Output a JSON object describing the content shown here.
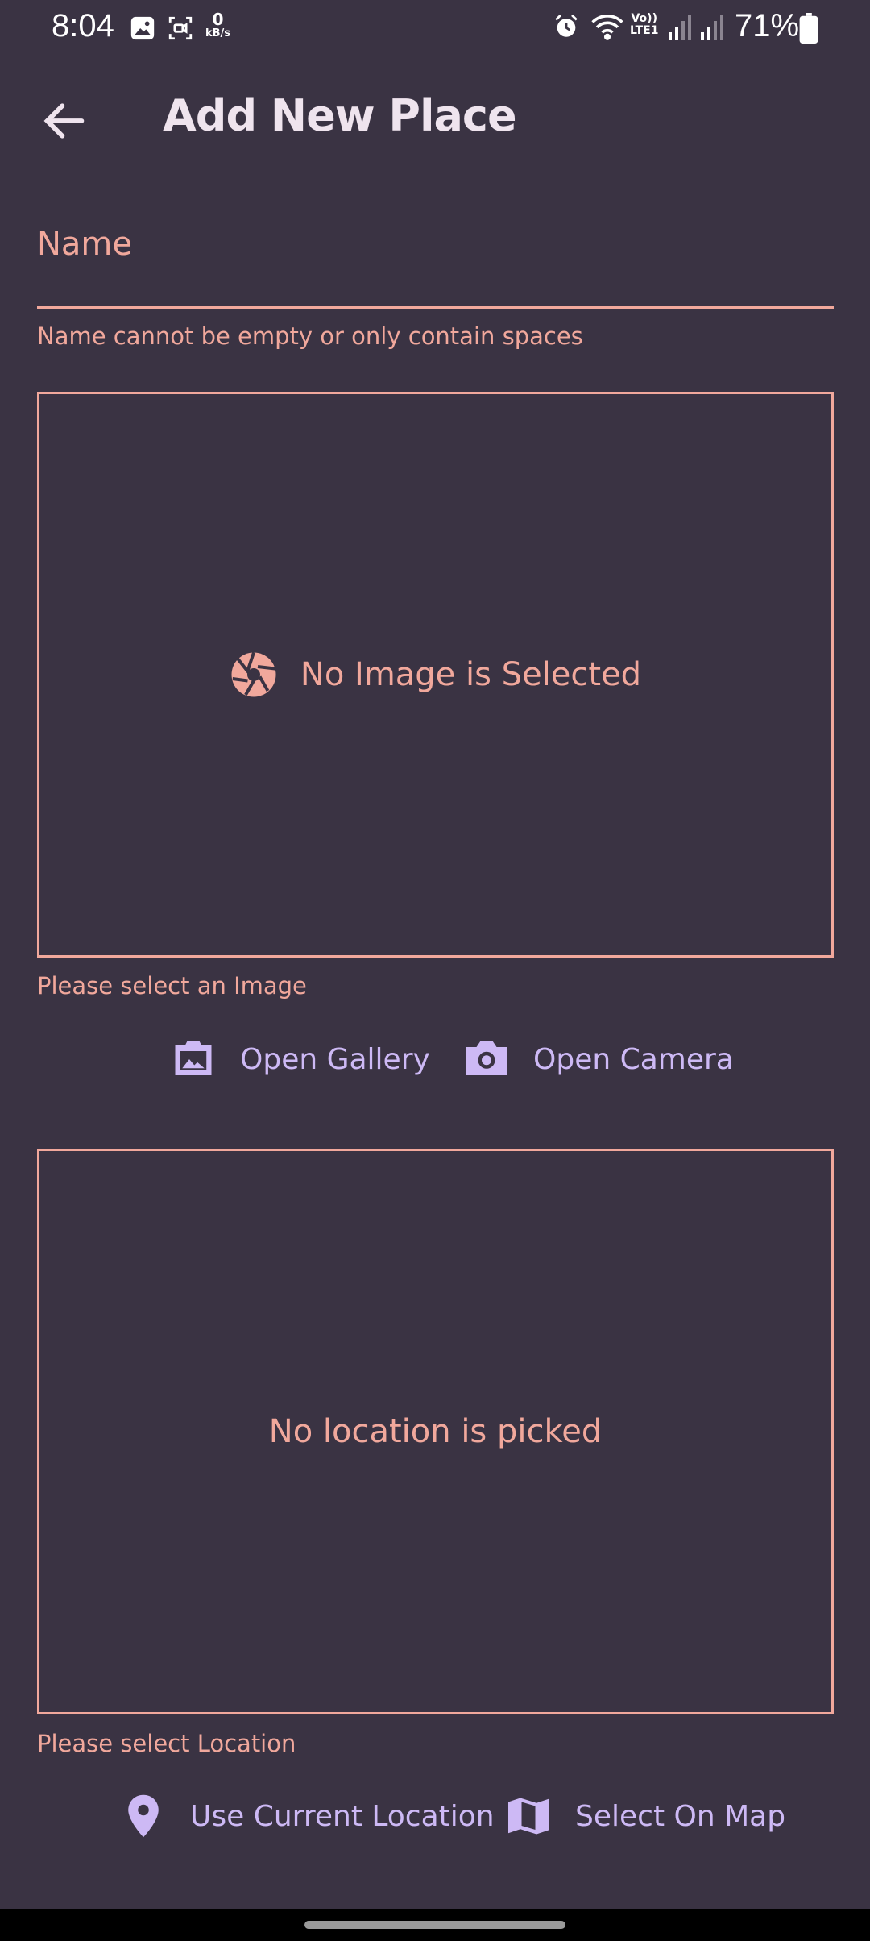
{
  "status_bar": {
    "time": "8:04",
    "speed_value": "0",
    "speed_unit": "kB/s",
    "volte_line1": "Vo))",
    "volte_line2": "LTE1",
    "battery": "71%"
  },
  "app_bar": {
    "title": "Add New Place",
    "back_icon": "arrow-left-icon"
  },
  "form": {
    "name_placeholder": "Name",
    "name_value": "",
    "name_error": "Name cannot be empty or only contain spaces"
  },
  "image_section": {
    "placeholder": "No Image is Selected",
    "placeholder_icon": "camera-shutter-icon",
    "error": "Please select an Image",
    "gallery_label": "Open Gallery",
    "gallery_icon": "gallery-icon",
    "camera_label": "Open Camera",
    "camera_icon": "camera-icon"
  },
  "location_section": {
    "placeholder": "No location is picked",
    "error": "Please select Location",
    "current_location_label": "Use Current Location",
    "current_location_icon": "location-pin-icon",
    "map_label": "Select On Map",
    "map_icon": "map-icon"
  },
  "colors": {
    "background": "#3a3343",
    "error_accent": "#f1a89c",
    "primary": "#cdb9f5",
    "title": "#efe4ee"
  }
}
